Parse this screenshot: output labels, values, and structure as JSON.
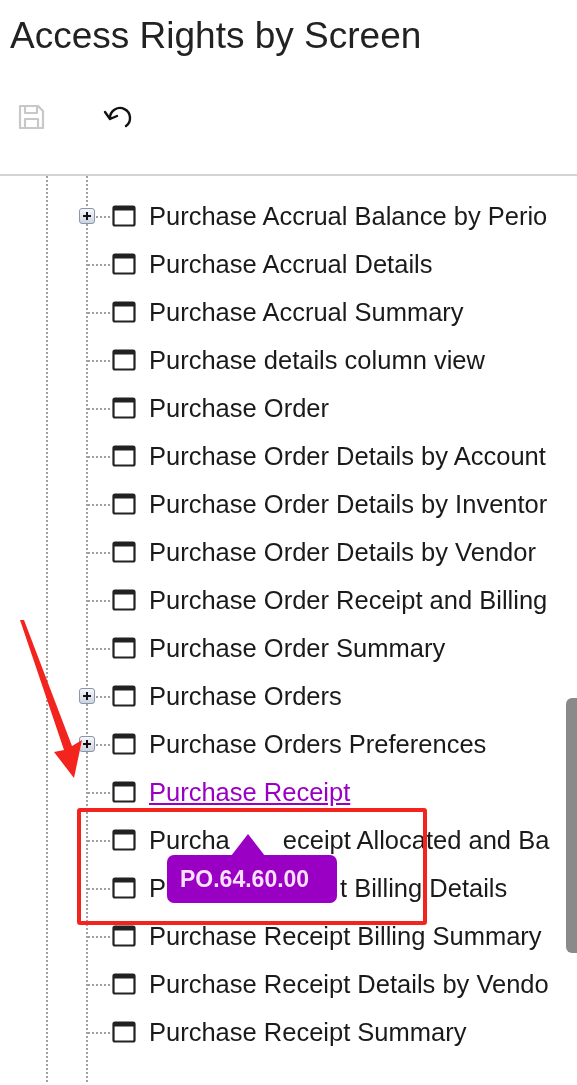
{
  "title": "Access Rights by Screen",
  "toolbar": [
    {
      "kind": "save",
      "disabled": true
    },
    {
      "kind": "undo",
      "disabled": false
    }
  ],
  "tree": [
    {
      "label": "Purchase Accrual Balance by Perio",
      "expandable": true,
      "selected": false
    },
    {
      "label": "Purchase Accrual Details",
      "expandable": false,
      "selected": false
    },
    {
      "label": "Purchase Accrual Summary",
      "expandable": false,
      "selected": false
    },
    {
      "label": "Purchase details column view",
      "expandable": false,
      "selected": false
    },
    {
      "label": "Purchase Order",
      "expandable": false,
      "selected": false
    },
    {
      "label": "Purchase Order Details by Account",
      "expandable": false,
      "selected": false
    },
    {
      "label": "Purchase Order Details by Inventor",
      "expandable": false,
      "selected": false
    },
    {
      "label": "Purchase Order Details by Vendor",
      "expandable": false,
      "selected": false
    },
    {
      "label": "Purchase Order Receipt and Billing",
      "expandable": false,
      "selected": false
    },
    {
      "label": "Purchase Order Summary",
      "expandable": false,
      "selected": false
    },
    {
      "label": "Purchase Orders",
      "expandable": true,
      "selected": false
    },
    {
      "label": "Purchase Orders Preferences",
      "expandable": true,
      "selected": false
    },
    {
      "label": "Purchase Receipt",
      "expandable": false,
      "selected": true
    },
    {
      "label_parts": [
        "Purcha",
        "eceipt Allocated and Ba"
      ],
      "expandable": false,
      "selected": false
    },
    {
      "label_parts": [
        "P",
        "t Billing Details"
      ],
      "expandable": false,
      "selected": false
    },
    {
      "label": "Purchase Receipt Billing Summary",
      "expandable": false,
      "selected": false
    },
    {
      "label": "Purchase Receipt Details by Vendo",
      "expandable": false,
      "selected": false
    },
    {
      "label": "Purchase Receipt Summary",
      "expandable": false,
      "selected": false
    }
  ],
  "tooltip": {
    "text": "PO.64.60.00"
  }
}
